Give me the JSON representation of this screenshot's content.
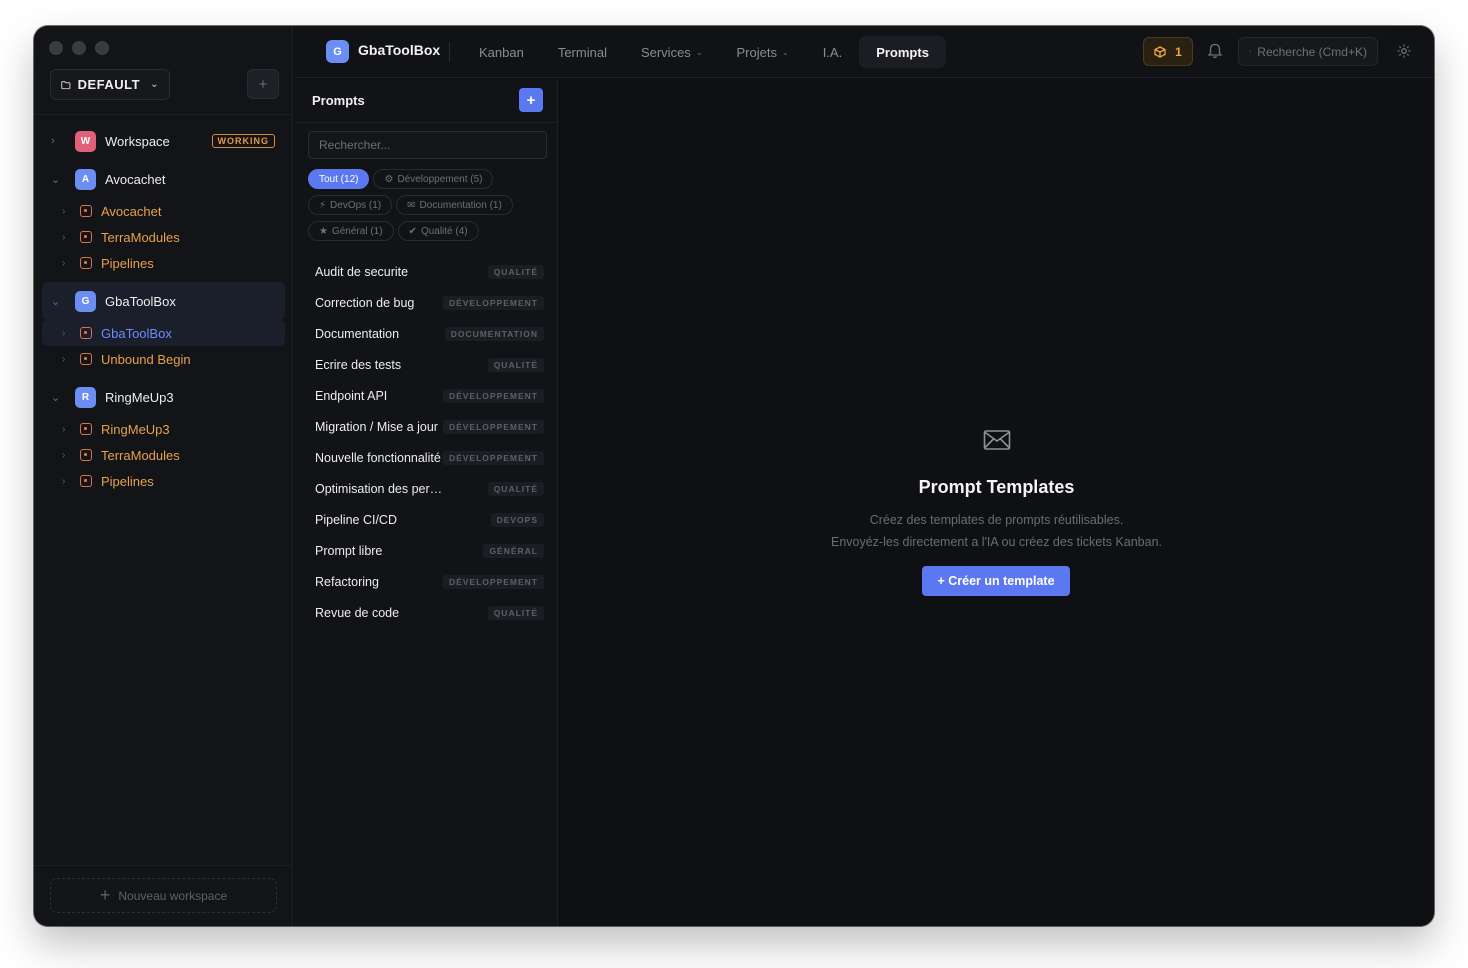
{
  "sidebar": {
    "workspace_selector": "DEFAULT",
    "add_label": "+",
    "tree": [
      {
        "letter": "W",
        "name": "Workspace",
        "color": "#e0607a",
        "expanded": false,
        "badge": "WORKING",
        "children": []
      },
      {
        "letter": "A",
        "name": "Avocachet",
        "color": "#6c8ef2",
        "expanded": true,
        "children": [
          "Avocachet",
          "TerraModules",
          "Pipelines"
        ]
      },
      {
        "letter": "G",
        "name": "GbaToolBox",
        "color": "#6c8ef2",
        "expanded": true,
        "selected": true,
        "children": [
          "GbaToolBox",
          "Unbound Begin"
        ]
      },
      {
        "letter": "R",
        "name": "RingMeUp3",
        "color": "#6c8ef2",
        "expanded": true,
        "children": [
          "RingMeUp3",
          "TerraModules",
          "Pipelines"
        ]
      }
    ],
    "new_workspace": "Nouveau workspace"
  },
  "topbar": {
    "app_letter": "G",
    "app_name": "GbaToolBox",
    "nav": [
      {
        "label": "Kanban",
        "dropdown": false,
        "active": false
      },
      {
        "label": "Terminal",
        "dropdown": false,
        "active": false
      },
      {
        "label": "Services",
        "dropdown": true,
        "active": false
      },
      {
        "label": "Projets",
        "dropdown": true,
        "active": false
      },
      {
        "label": "I.A.",
        "dropdown": false,
        "active": false
      },
      {
        "label": "Prompts",
        "dropdown": false,
        "active": true
      }
    ],
    "notification_count": "1",
    "search_placeholder": "Recherche (Cmd+K)"
  },
  "prompts_panel": {
    "title": "Prompts",
    "add_label": "+",
    "search_placeholder": "Rechercher...",
    "filters": [
      {
        "label": "Tout (12)",
        "active": true,
        "icon": ""
      },
      {
        "label": "Développement (5)",
        "active": false,
        "icon": "⚙"
      },
      {
        "label": "DevOps (1)",
        "active": false,
        "icon": "⚡"
      },
      {
        "label": "Documentation (1)",
        "active": false,
        "icon": "✉"
      },
      {
        "label": "Général (1)",
        "active": false,
        "icon": "★"
      },
      {
        "label": "Qualité (4)",
        "active": false,
        "icon": "✔"
      }
    ],
    "items": [
      {
        "name": "Audit de securite",
        "tag": "QUALITÉ"
      },
      {
        "name": "Correction de bug",
        "tag": "DÉVELOPPEMENT"
      },
      {
        "name": "Documentation",
        "tag": "DOCUMENTATION"
      },
      {
        "name": "Ecrire des tests",
        "tag": "QUALITÉ"
      },
      {
        "name": "Endpoint API",
        "tag": "DÉVELOPPEMENT"
      },
      {
        "name": "Migration / Mise a jour",
        "tag": "DÉVELOPPEMENT"
      },
      {
        "name": "Nouvelle fonctionnalité",
        "tag": "DÉVELOPPEMENT"
      },
      {
        "name": "Optimisation des performances",
        "tag": "QUALITÉ"
      },
      {
        "name": "Pipeline CI/CD",
        "tag": "DEVOPS"
      },
      {
        "name": "Prompt libre",
        "tag": "GÉNÉRAL"
      },
      {
        "name": "Refactoring",
        "tag": "DÉVELOPPEMENT"
      },
      {
        "name": "Revue de code",
        "tag": "QUALITÉ"
      }
    ]
  },
  "main": {
    "icon": "envelope-icon",
    "title": "Prompt Templates",
    "desc_line1": "Créez des templates de prompts réutilisables.",
    "desc_line2": "Envoyéz-les directement a l'IA ou créez des tickets Kanban.",
    "create_button": "+ Créer un template"
  },
  "colors": {
    "accent": "#5b78f0",
    "project_orange": "#e8a04c",
    "working_badge": "#e49a48"
  }
}
